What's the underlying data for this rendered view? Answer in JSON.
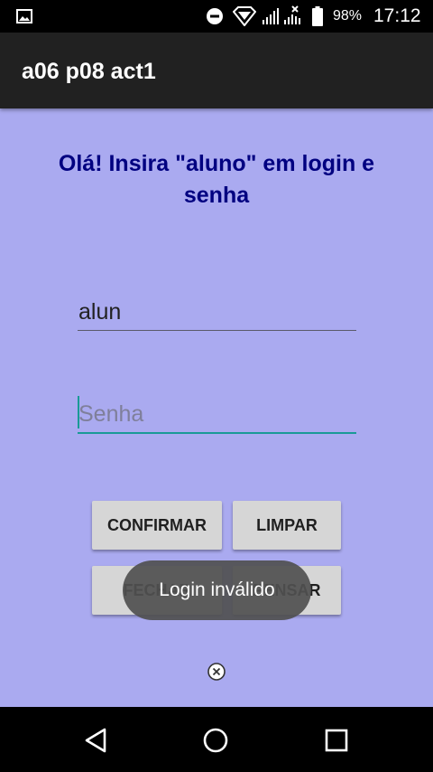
{
  "status_bar": {
    "battery_percent": "98%",
    "time": "17:12",
    "icons": [
      "gallery-icon",
      "do-not-disturb-icon",
      "wifi-icon",
      "signal-icon",
      "signal-no-data-icon",
      "battery-icon"
    ]
  },
  "app_bar": {
    "title": "a06 p08 act1"
  },
  "main": {
    "heading": "Olá! Insira \"aluno\" em login e senha",
    "login_value": "alun",
    "password_value": "",
    "password_placeholder": "Senha",
    "buttons": {
      "confirm": "CONFIRMAR",
      "clear": "LIMPAR",
      "close": "FECHAR",
      "think": "PENSAR"
    }
  },
  "toast": {
    "message": "Login inválido"
  },
  "nav_bar": {
    "icons": [
      "back-icon",
      "home-icon",
      "recent-apps-icon"
    ]
  },
  "colors": {
    "background": "#aaaaf0",
    "heading": "#000080",
    "app_bar": "#212121",
    "accent": "#1a9a96",
    "button": "#d6d6d6"
  }
}
